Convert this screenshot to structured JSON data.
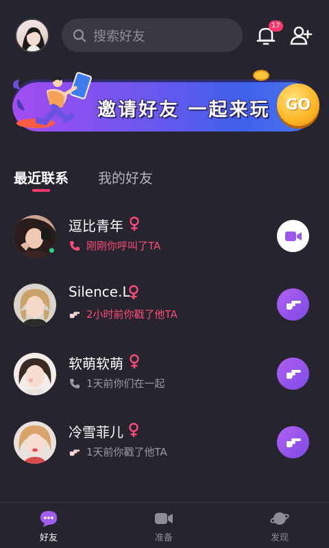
{
  "header": {
    "search_placeholder": "搜索好友",
    "notification_count": "17"
  },
  "banner": {
    "title": "邀请好友 一起来玩",
    "go_label": "GO"
  },
  "tabs": [
    {
      "label": "最近联系",
      "active": true
    },
    {
      "label": "我的好友",
      "active": false
    }
  ],
  "contacts": [
    {
      "name": "逗比青年",
      "gender": "female",
      "status": "刚刚你呼叫了TA",
      "status_icon": "phone-icon",
      "status_color": "#ff4a79",
      "action": "video-call-icon",
      "online": true
    },
    {
      "name": "Silence.L",
      "gender": "female",
      "status": "2小时前你戳了他TA",
      "status_icon": "poke-hand-icon",
      "status_color": "#ff4a79",
      "action": "poke-icon",
      "online": false
    },
    {
      "name": "软萌软萌",
      "gender": "female",
      "status": "1天前你们在一起",
      "status_icon": "phone-icon",
      "status_color": "#9d9aa6",
      "action": "poke-icon",
      "online": false
    },
    {
      "name": "冷雪菲儿",
      "gender": "female",
      "status": "1天前你戳了他TA",
      "status_icon": "poke-hand-icon",
      "status_color": "#9d9aa6",
      "action": "poke-icon",
      "online": false
    }
  ],
  "bottom_nav": [
    {
      "label": "好友",
      "icon": "chat-bubble-icon",
      "active": true
    },
    {
      "label": "准备",
      "icon": "video-camera-icon",
      "active": false
    },
    {
      "label": "发现",
      "icon": "planet-icon",
      "active": false
    }
  ],
  "colors": {
    "background": "#26242e",
    "accent_pink": "#ff3a6a",
    "accent_purple": "#9d57ec",
    "online_green": "#2fd07b"
  }
}
